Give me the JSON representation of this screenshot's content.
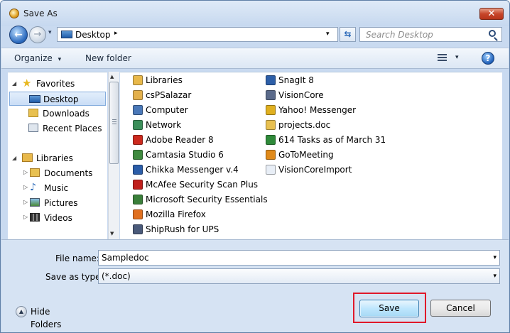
{
  "window": {
    "title": "Save As"
  },
  "address": {
    "location": "Desktop",
    "arrow": "▸",
    "dropdown": "▾"
  },
  "search": {
    "placeholder": "Search Desktop"
  },
  "toolbar": {
    "organize_label": "Organize",
    "organize_arrow": "▾",
    "new_folder_label": "New folder",
    "views_arrow": "▾",
    "help_glyph": "?"
  },
  "nav_pane": {
    "favorites": {
      "label": "Favorites",
      "items": [
        {
          "label": "Desktop",
          "icon": "desktop-icon",
          "selected": true
        },
        {
          "label": "Downloads",
          "icon": "downloads-folder-icon"
        },
        {
          "label": "Recent Places",
          "icon": "recent-places-icon"
        }
      ]
    },
    "libraries": {
      "label": "Libraries",
      "items": [
        {
          "label": "Documents",
          "icon": "documents-icon"
        },
        {
          "label": "Music",
          "icon": "music-icon"
        },
        {
          "label": "Pictures",
          "icon": "pictures-icon"
        },
        {
          "label": "Videos",
          "icon": "videos-icon"
        }
      ]
    }
  },
  "files": {
    "column1": [
      {
        "label": "Libraries",
        "icon": "libraries-icon",
        "color": "#e8b84a"
      },
      {
        "label": "csPSalazar",
        "icon": "user-folder-icon",
        "color": "#e3b04c"
      },
      {
        "label": "Computer",
        "icon": "computer-icon",
        "color": "#4a78b8"
      },
      {
        "label": "Network",
        "icon": "network-icon",
        "color": "#3b8f5a"
      },
      {
        "label": "Adobe Reader 8",
        "icon": "adobe-reader-icon",
        "color": "#cc2a1e"
      },
      {
        "label": "Camtasia Studio 6",
        "icon": "camtasia-icon",
        "color": "#3f8a3f"
      },
      {
        "label": "Chikka Messenger v.4",
        "icon": "chikka-icon",
        "color": "#2b5da8"
      },
      {
        "label": "McAfee Security Scan Plus",
        "icon": "mcafee-icon",
        "color": "#c0201c"
      },
      {
        "label": "Microsoft Security Essentials",
        "icon": "security-essentials-icon",
        "color": "#3a7f3a"
      },
      {
        "label": "Mozilla Firefox",
        "icon": "firefox-icon",
        "color": "#e07020"
      },
      {
        "label": "ShipRush for UPS",
        "icon": "shiprush-icon",
        "color": "#4a5a7a"
      }
    ],
    "column2": [
      {
        "label": "SnagIt 8",
        "icon": "snagit-icon",
        "color": "#2d5fa8"
      },
      {
        "label": "VisionCore",
        "icon": "visioncore-icon",
        "color": "#5a6a8a"
      },
      {
        "label": "Yahoo! Messenger",
        "icon": "yahoo-messenger-icon",
        "color": "#e0b020"
      },
      {
        "label": "projects.doc",
        "icon": "folder-icon",
        "color": "#e8c050"
      },
      {
        "label": "614 Tasks as of March 31",
        "icon": "excel-icon",
        "color": "#2f8a3a"
      },
      {
        "label": "GoToMeeting",
        "icon": "gotomeeting-icon",
        "color": "#e08a1a"
      },
      {
        "label": "VisionCoreImport",
        "icon": "document-icon",
        "color": "#e8eef6"
      }
    ]
  },
  "form": {
    "filename_label": "File name:",
    "filename_value": "Sampledoc",
    "savetype_label": "Save as type:",
    "savetype_value": "(*.doc)",
    "dropdown": "▾"
  },
  "footer": {
    "hide_folders_label": "Hide Folders",
    "save_label": "Save",
    "cancel_label": "Cancel"
  },
  "colors": {
    "highlight": "#e0182a",
    "accent": "#3c7fb1"
  }
}
